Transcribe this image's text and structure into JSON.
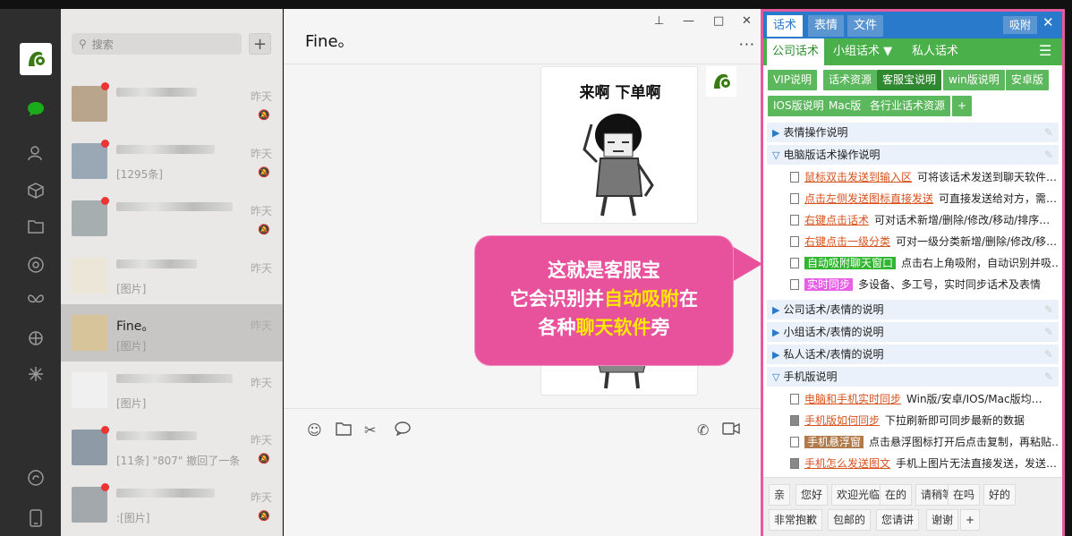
{
  "nav": {
    "icons": [
      "logo-icon",
      "chat-icon",
      "contacts-icon",
      "cube-icon",
      "folder-icon",
      "aperture-icon",
      "butterfly-icon",
      "cube-outline-icon",
      "sparkle-icon",
      "mini-program-icon",
      "phone-icon"
    ]
  },
  "search": {
    "placeholder": "搜索",
    "add": "+"
  },
  "conversations": [
    {
      "name": "",
      "msg": "",
      "time": "昨天",
      "unread": true,
      "muted": true
    },
    {
      "name": "",
      "msg": "[1295条]",
      "time": "昨天",
      "unread": true,
      "muted": true
    },
    {
      "name": "",
      "msg": "",
      "time": "昨天",
      "unread": true,
      "muted": true
    },
    {
      "name": "",
      "msg": "[图片]",
      "time": "昨天",
      "unread": false,
      "muted": false
    },
    {
      "name": "Fine。",
      "msg": "[图片]",
      "time": "昨天",
      "unread": false,
      "muted": false
    },
    {
      "name": "",
      "msg": "[图片]",
      "time": "昨天",
      "unread": false,
      "muted": false
    },
    {
      "name": "",
      "msg": "[11条] \"807\" 撤回了一条",
      "time": "昨天",
      "unread": true,
      "muted": true
    },
    {
      "name": "",
      "msg": ":[图片]",
      "time": "昨天",
      "unread": true,
      "muted": true
    }
  ],
  "chat": {
    "title": "Fine。",
    "sticker_text": "来啊 下单啊",
    "window": {
      "pin": "⊥",
      "min": "—",
      "max": "□",
      "close": "✕"
    },
    "more": "···"
  },
  "callout": {
    "line1": "这就是客服宝",
    "line2_a": "它会识别并",
    "line2_hl": "自动吸附",
    "line2_b": "在",
    "line3_a": "各种",
    "line3_hl": "聊天软件",
    "line3_b": "旁"
  },
  "panel": {
    "tabs": [
      "话术",
      "表情",
      "文件"
    ],
    "attach": "吸附",
    "close": "✕",
    "subtabs": [
      "公司话术",
      "小组话术 ▼",
      "私人话术"
    ],
    "groups_row1": [
      "VIP说明",
      "话术资源",
      "客服宝说明",
      "win版说明",
      "安卓版"
    ],
    "groups_row2": [
      "IOS版说明",
      "Mac版",
      "各行业话术资源",
      "+"
    ],
    "categories": [
      {
        "label": "表情操作说明",
        "open": false
      },
      {
        "label": "电脑版话术操作说明",
        "open": true
      },
      {
        "label": "公司话术/表情的说明",
        "open": false
      },
      {
        "label": "小组话术/表情的说明",
        "open": false
      },
      {
        "label": "私人话术/表情的说明",
        "open": false
      },
      {
        "label": "手机版说明",
        "open": true
      }
    ],
    "pc_items": [
      {
        "link": "鼠标双击发送到输入区",
        "text": "可将该话术发送到聊天软件…",
        "style": "underline"
      },
      {
        "link": "点击左侧发送图标直接发送",
        "text": "可直接发送给对方，需…",
        "style": "underline"
      },
      {
        "link": "右键点击话术",
        "text": "可对话术新增/删除/修改/移动/排序…",
        "style": "underline"
      },
      {
        "link": "右键点击一级分类",
        "text": "可对一级分类新增/删除/修改/移…",
        "style": "underline"
      },
      {
        "link": "自动吸附聊天窗口",
        "text": "点击右上角吸附，自动识别并吸…",
        "style": "green"
      },
      {
        "link": "实时同步",
        "text": "多设备、多工号，实时同步话术及表情",
        "style": "magenta"
      }
    ],
    "mobile_items": [
      {
        "link": "电脑和手机实时同步",
        "text": "Win版/安卓/IOS/Mac版均…",
        "style": "underline",
        "icon": "doc"
      },
      {
        "link": "手机版如何同步",
        "text": "下拉刷新即可同步最新的数据",
        "style": "underline",
        "icon": "img"
      },
      {
        "link": "手机悬浮窗",
        "text": "点击悬浮图标打开后点击复制，再粘贴…",
        "style": "brown",
        "icon": "doc"
      },
      {
        "link": "手机怎么发送图文",
        "text": "手机上图片无法直接发送，发送…",
        "style": "underline",
        "icon": "img"
      }
    ],
    "quick_row1": [
      "亲",
      "您好",
      "欢迎光临",
      "在的",
      "请稍等",
      "在吗",
      "好的"
    ],
    "quick_row2": [
      "非常抱歉",
      "包邮的",
      "您请讲",
      "谢谢",
      "+"
    ]
  },
  "colors": {
    "accent_blue": "#2a7acb",
    "accent_green": "#4ab04a",
    "callout_pink": "#e8519c",
    "highlight_yellow": "#ffe800",
    "link_orange": "#d9531e",
    "panel_border": "#e35a9e"
  }
}
